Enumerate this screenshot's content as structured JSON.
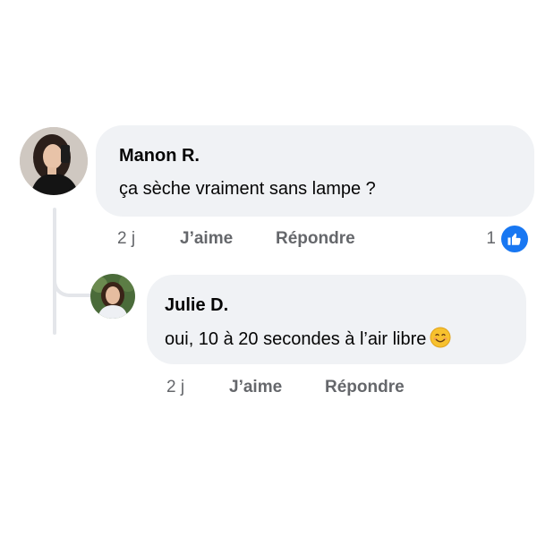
{
  "comment": {
    "author": "Manon R.",
    "text": "ça sèche vraiment sans lampe ?",
    "time": "2 j",
    "like_label": "J’aime",
    "reply_label": "Répondre",
    "reaction_count": "1",
    "reaction_icon": "like-thumb-icon"
  },
  "reply": {
    "author": "Julie D.",
    "text": "oui, 10 à 20 secondes à l’air libre",
    "emoji": "smiling-face-icon",
    "time": "2 j",
    "like_label": "J’aime",
    "reply_label": "Répondre"
  },
  "colors": {
    "bubble": "#f0f2f5",
    "secondary_text": "#65676b",
    "like_blue": "#1877f2",
    "thread_line": "#e4e6ea"
  }
}
